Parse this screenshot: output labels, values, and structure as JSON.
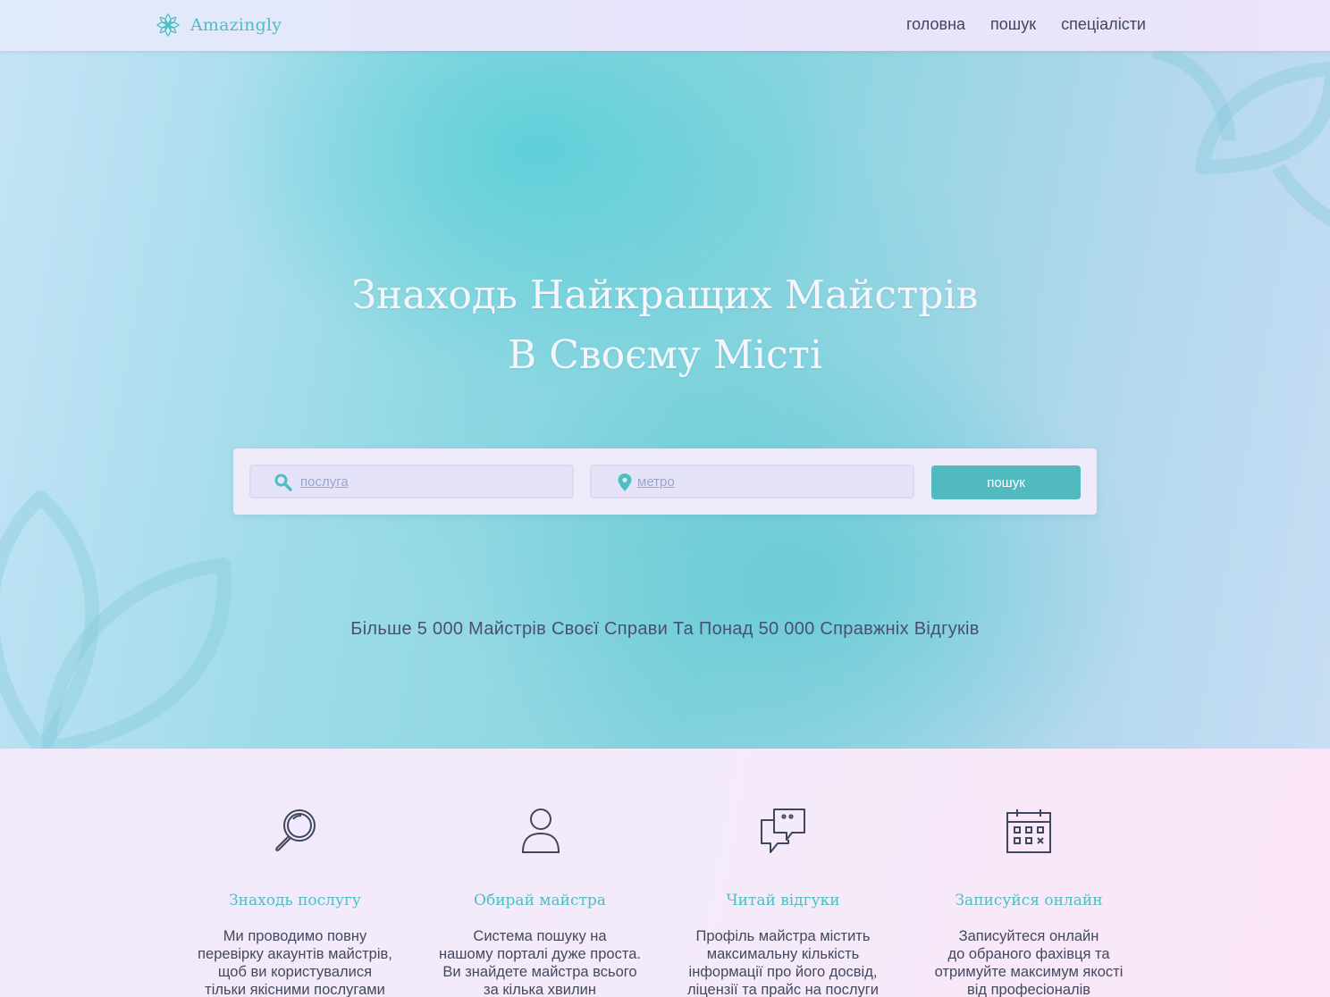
{
  "header": {
    "logo_text": "Amazingly",
    "logo_icon": "lotus-icon",
    "nav": [
      "головна",
      "пошук",
      "спеціалісти"
    ]
  },
  "hero": {
    "title_line1": "Знаходь Найкращих Майстрів",
    "title_line2": "В Своєму Місті",
    "search": {
      "service_placeholder": "послуга",
      "service_icon": "search-icon",
      "metro_placeholder": "метро",
      "metro_icon": "map-pin-icon",
      "button_label": "пошук"
    },
    "subtitle": "Більше 5 000 Майстрів Своєї Справи Та Понад 50 000 Справжніх Відгуків"
  },
  "features": [
    {
      "icon": "magnifier-icon",
      "title": "Знаходь послугу",
      "text": "Ми проводимо повну\nперевірку акаунтів майстрів,\nщоб ви користувалися\nтільки якісними послугами"
    },
    {
      "icon": "user-icon",
      "title": "Обирай майстра",
      "text": "Система пошуку на\nнашому порталі дуже проста.\nВи знайдете майстра всього\nза кілька хвилин"
    },
    {
      "icon": "chat-bubbles-icon",
      "title": "Читай відгуки",
      "text": "Профіль майстра містить\nмаксимальну кількість\nінформації про його досвід,\nліцензії та прайс на послуги"
    },
    {
      "icon": "calendar-icon",
      "title": "Записуйся онлайн",
      "text": "Записуйтеся онлайн\n до обраного фахівця та\nотримуйте максимум якості\nвід професіоналів"
    }
  ],
  "colors": {
    "accent": "#4dbfc3",
    "button": "#51b9bf",
    "text_dark": "#43485f"
  }
}
